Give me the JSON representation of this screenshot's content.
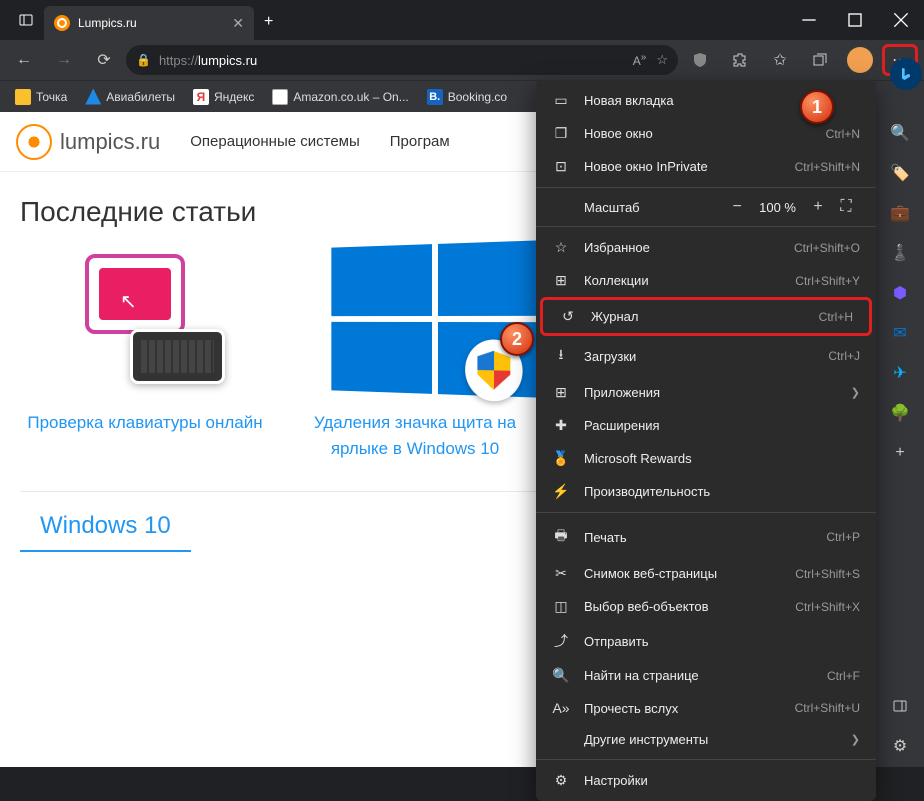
{
  "window": {
    "title": "Lumpics.ru"
  },
  "address": {
    "protocol": "https://",
    "host": "lumpics.ru"
  },
  "bookmarks": [
    {
      "label": "Точка",
      "color": "#fbc02d"
    },
    {
      "label": "Авиабилеты",
      "color": "#1e88e5"
    },
    {
      "label": "Яндекс",
      "color": "#e53935"
    },
    {
      "label": "Amazon.co.uk – On...",
      "color": "#fff"
    },
    {
      "label": "Booking.co",
      "color": "#1565c0"
    }
  ],
  "site": {
    "logo_text": "lumpics.ru",
    "nav": [
      "Операционные системы",
      "Програм"
    ]
  },
  "sections": {
    "latest_title": "Последние статьи",
    "win10_title": "Windows 10"
  },
  "cards": [
    {
      "title": "Проверка клавиатуры онлайн"
    },
    {
      "title": "Удаления значка щита на ярлыке в Windows 10"
    }
  ],
  "menu": {
    "new_tab": "Новая вкладка",
    "new_window": {
      "label": "Новое окно",
      "shortcut": "Ctrl+N"
    },
    "new_inprivate": {
      "label": "Новое окно InPrivate",
      "shortcut": "Ctrl+Shift+N"
    },
    "zoom": {
      "label": "Масштаб",
      "value": "100 %"
    },
    "favorites": {
      "label": "Избранное",
      "shortcut": "Ctrl+Shift+O"
    },
    "collections": {
      "label": "Коллекции",
      "shortcut": "Ctrl+Shift+Y"
    },
    "history": {
      "label": "Журнал",
      "shortcut": "Ctrl+H"
    },
    "downloads": {
      "label": "Загрузки",
      "shortcut": "Ctrl+J"
    },
    "apps": {
      "label": "Приложения"
    },
    "extensions": {
      "label": "Расширения"
    },
    "rewards": {
      "label": "Microsoft Rewards"
    },
    "performance": {
      "label": "Производительность"
    },
    "print": {
      "label": "Печать",
      "shortcut": "Ctrl+P"
    },
    "screenshot": {
      "label": "Снимок веб-страницы",
      "shortcut": "Ctrl+Shift+S"
    },
    "web_select": {
      "label": "Выбор веб-объектов",
      "shortcut": "Ctrl+Shift+X"
    },
    "share": {
      "label": "Отправить"
    },
    "find": {
      "label": "Найти на странице",
      "shortcut": "Ctrl+F"
    },
    "read_aloud": {
      "label": "Прочесть вслух",
      "shortcut": "Ctrl+Shift+U"
    },
    "more_tools": {
      "label": "Другие инструменты"
    },
    "settings": {
      "label": "Настройки"
    }
  },
  "callouts": {
    "one": "1",
    "two": "2"
  }
}
